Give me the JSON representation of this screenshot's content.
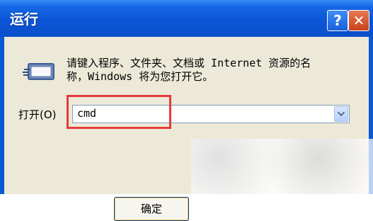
{
  "window": {
    "title": "运行",
    "help_glyph": "?",
    "close_glyph": "✕"
  },
  "content": {
    "description_line1": "请键入程序、文件夹、文档或 Internet 资源的名",
    "description_line2": "称，Windows 将为您打开它。",
    "open_label": "打开(O)",
    "open_value": "cmd",
    "ok_label": "确定"
  },
  "icons": {
    "run_icon": "run-dialog-icon",
    "dropdown_icon": "chevron-down-icon",
    "help_icon": "help-icon",
    "close_icon": "close-icon"
  },
  "colors": {
    "titlebar": "#0b55d5",
    "client_bg": "#ece9d8",
    "highlight": "#e53a3a"
  }
}
